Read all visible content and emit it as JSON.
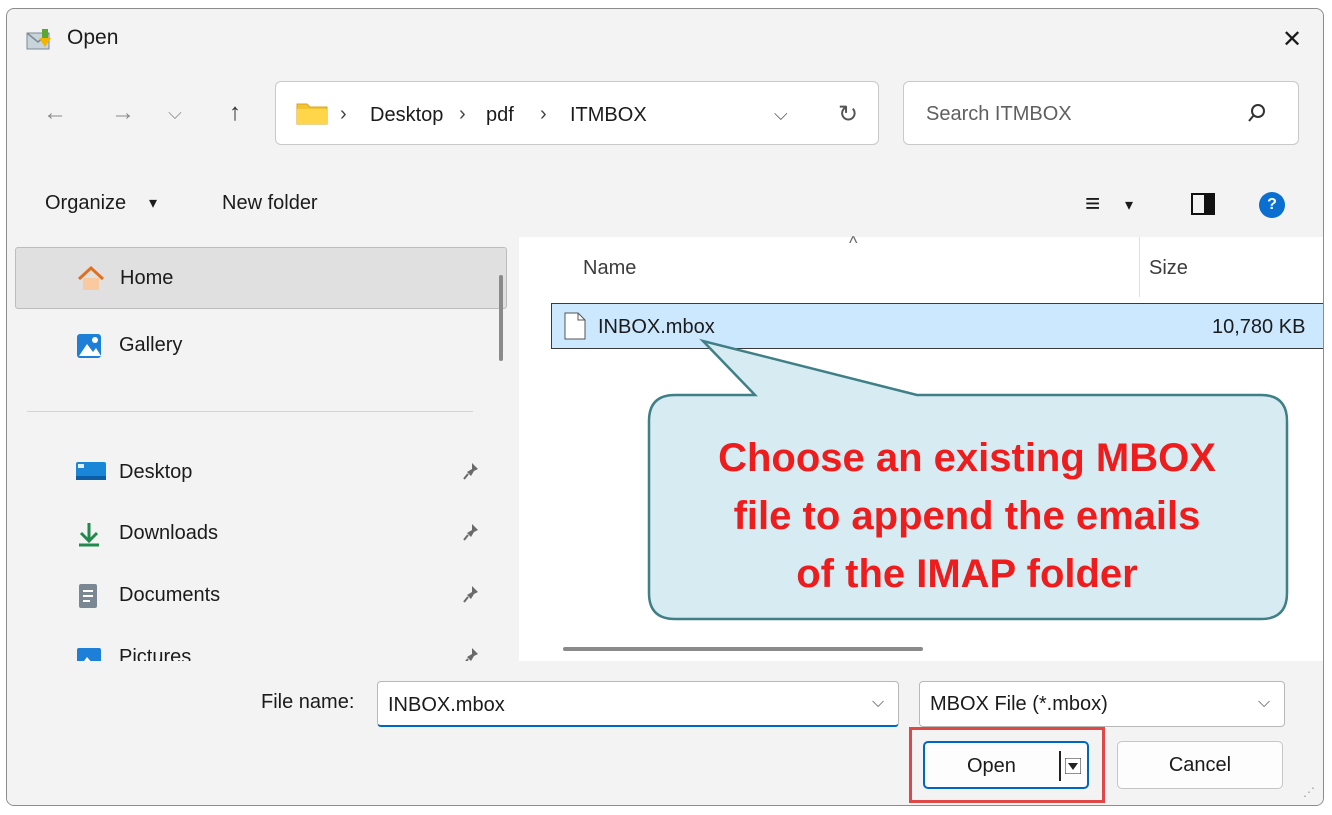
{
  "window": {
    "title": "Open",
    "close_glyph": "✕"
  },
  "nav": {
    "back_glyph": "←",
    "forward_glyph": "→",
    "recent_glyph": "⌵",
    "up_glyph": "↑"
  },
  "address_bar": {
    "crumbs": [
      "Desktop",
      "pdf",
      "ITMBOX"
    ],
    "separator": "›",
    "dropdown_glyph": "⌵",
    "refresh_glyph": "↻"
  },
  "search": {
    "placeholder": "Search ITMBOX",
    "icon": "search-icon"
  },
  "toolbar": {
    "organize_label": "Organize",
    "organize_caret": "▾",
    "new_folder_label": "New folder",
    "view_glyph": "≡",
    "view_caret": "▾",
    "help_glyph": "?"
  },
  "sidebar": {
    "items": [
      {
        "label": "Home",
        "icon": "home-icon",
        "selected": true
      },
      {
        "label": "Gallery",
        "icon": "gallery-icon"
      },
      {
        "label": "Desktop",
        "icon": "desktop-icon",
        "pinned": true
      },
      {
        "label": "Downloads",
        "icon": "downloads-icon",
        "pinned": true
      },
      {
        "label": "Documents",
        "icon": "documents-icon",
        "pinned": true
      },
      {
        "label": "Pictures",
        "icon": "pictures-icon",
        "pinned": true
      }
    ]
  },
  "file_list": {
    "columns": {
      "name": "Name",
      "size": "Size"
    },
    "sort_glyph": "^",
    "rows": [
      {
        "name": "INBOX.mbox",
        "size": "10,780 KB",
        "selected": true
      }
    ]
  },
  "callout": {
    "text": "Choose an existing MBOX file to append the emails of the IMAP folder",
    "lines": [
      "Choose an existing MBOX",
      "file to append the emails",
      "of the IMAP folder"
    ],
    "text_color": "#ee1c1c",
    "bubble_color": "#d7ecf2"
  },
  "footer": {
    "file_name_label": "File name:",
    "file_name_value": "INBOX.mbox",
    "file_type_value": "MBOX File (*.mbox)",
    "open_label": "Open",
    "cancel_label": "Cancel",
    "dropdown_glyph": "⌵",
    "highlight_color": "#e04848"
  },
  "colors": {
    "accent": "#0067c0",
    "selection": "#cce8ff",
    "folder": "#f4c430"
  }
}
